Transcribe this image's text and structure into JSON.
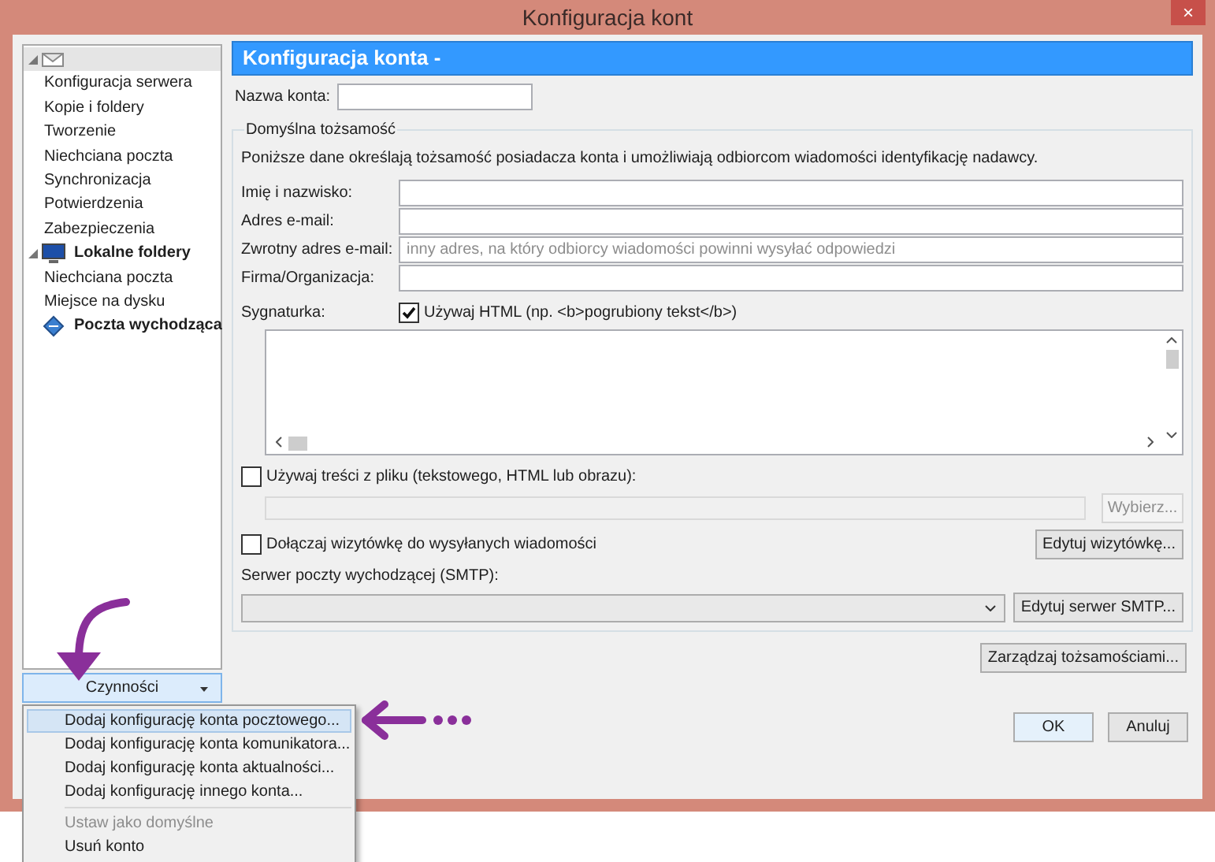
{
  "window": {
    "title": "Konfiguracja kont",
    "close_button": "×"
  },
  "sidebar": {
    "items": [
      {
        "kind": "account",
        "selected": true,
        "expanded": true,
        "children": [
          {
            "label": "Konfiguracja serwera"
          },
          {
            "label": "Kopie i foldery"
          },
          {
            "label": "Tworzenie"
          },
          {
            "label": "Niechciana poczta"
          },
          {
            "label": "Synchronizacja"
          },
          {
            "label": "Potwierdzenia"
          },
          {
            "label": "Zabezpieczenia"
          }
        ]
      },
      {
        "kind": "local",
        "label": "Lokalne foldery",
        "selected": false,
        "expanded": true,
        "children": [
          {
            "label": "Niechciana poczta"
          },
          {
            "label": "Miejsce na dysku"
          }
        ]
      },
      {
        "kind": "outbox",
        "label": "Poczta wychodząca",
        "selected": false
      }
    ]
  },
  "panel": {
    "header": "Konfiguracja konta -",
    "account_name": {
      "label": "Nazwa konta:"
    },
    "identity": {
      "title": "Domyślna tożsamość",
      "description": "Poniższe dane określają tożsamość posiadacza konta i umożliwiają odbiorcom wiadomości identyfikację nadawcy.",
      "fields": [
        {
          "label": "Imię i nazwisko:"
        },
        {
          "label": "Adres e-mail:"
        },
        {
          "label": "Zwrotny adres e-mail:",
          "placeholder": "inny adres, na który odbiorcy wiadomości powinni wysyłać odpowiedzi"
        },
        {
          "label": "Firma/Organizacja:"
        }
      ],
      "signature": {
        "label": "Sygnaturka:",
        "use_html": {
          "label": "Używaj HTML (np. <b>pogrubiony tekst</b>)",
          "checked": true
        }
      },
      "use_file": {
        "label": "Używaj treści z pliku (tekstowego, HTML lub obrazu):",
        "checked": false
      },
      "file_button": {
        "label": "Wybierz...",
        "disabled": true
      },
      "attach_vcard": {
        "label": "Dołączaj wizytówkę do wysyłanych wiadomości",
        "checked": false
      },
      "edit_vcard_button": "Edytuj wizytówkę...",
      "smtp": {
        "label": "Serwer poczty wychodzącej (SMTP):",
        "button": "Edytuj serwer SMTP..."
      }
    },
    "manage_identities_button": "Zarządzaj tożsamościami..."
  },
  "actions_button": "Czynności",
  "actions_menu": [
    {
      "kind": "item",
      "label": "Dodaj konfigurację konta pocztowego...",
      "selected": true,
      "disabled": false
    },
    {
      "kind": "item",
      "label": "Dodaj konfigurację konta komunikatora...",
      "selected": false,
      "disabled": false
    },
    {
      "kind": "item",
      "label": "Dodaj konfigurację konta aktualności...",
      "selected": false,
      "disabled": false
    },
    {
      "kind": "item",
      "label": "Dodaj konfigurację innego konta...",
      "selected": false,
      "disabled": false
    },
    {
      "kind": "separator"
    },
    {
      "kind": "item",
      "label": "Ustaw jako domyślne",
      "selected": false,
      "disabled": true
    },
    {
      "kind": "item",
      "label": "Usuń konto",
      "selected": false,
      "disabled": false
    }
  ],
  "dialog_buttons": [
    {
      "label": "OK",
      "default": true
    },
    {
      "label": "Anuluj",
      "default": false
    }
  ]
}
